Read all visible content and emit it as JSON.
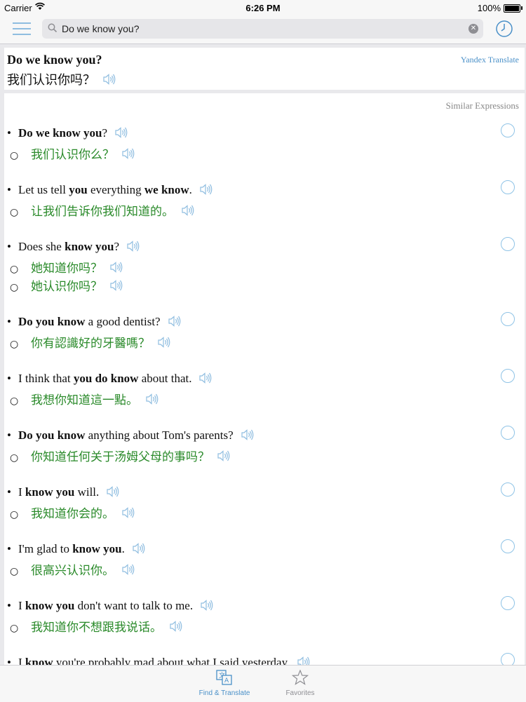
{
  "status_bar": {
    "carrier": "Carrier",
    "time": "6:26 PM",
    "battery": "100%"
  },
  "search": {
    "query": "Do we know you?",
    "placeholder": ""
  },
  "result": {
    "source": "Do we know you?",
    "translation": "我们认识你吗？",
    "provider": "Yandex Translate"
  },
  "similar": {
    "header": "Similar Expressions",
    "entries": [
      {
        "en": [
          [
            "Do we know you",
            true
          ],
          [
            "?",
            false
          ]
        ],
        "zh": [
          "我们认识你么？"
        ]
      },
      {
        "en": [
          [
            "Let us tell ",
            false
          ],
          [
            "you",
            true
          ],
          [
            " everything ",
            false
          ],
          [
            "we know",
            true
          ],
          [
            ".",
            false
          ]
        ],
        "zh": [
          "让我们告诉你我们知道的。"
        ]
      },
      {
        "en": [
          [
            "Does she ",
            false
          ],
          [
            "know you",
            true
          ],
          [
            "?",
            false
          ]
        ],
        "zh": [
          "她知道你吗？",
          "她认识你吗？"
        ]
      },
      {
        "en": [
          [
            "Do you know",
            true
          ],
          [
            " a good dentist?",
            false
          ]
        ],
        "zh": [
          "你有認識好的牙醫嗎？"
        ]
      },
      {
        "en": [
          [
            "I think that ",
            false
          ],
          [
            "you do know",
            true
          ],
          [
            " about that.",
            false
          ]
        ],
        "zh": [
          "我想你知道這一點。"
        ]
      },
      {
        "en": [
          [
            "Do you know",
            true
          ],
          [
            " anything about Tom's parents?",
            false
          ]
        ],
        "zh": [
          "你知道任何关于汤姆父母的事吗？"
        ]
      },
      {
        "en": [
          [
            "I ",
            false
          ],
          [
            "know you",
            true
          ],
          [
            " will.",
            false
          ]
        ],
        "zh": [
          "我知道你会的。"
        ]
      },
      {
        "en": [
          [
            "I'm glad to ",
            false
          ],
          [
            "know you",
            true
          ],
          [
            ".",
            false
          ]
        ],
        "zh": [
          "很高兴认识你。"
        ]
      },
      {
        "en": [
          [
            "I ",
            false
          ],
          [
            "know you",
            true
          ],
          [
            " don't want to talk to me.",
            false
          ]
        ],
        "zh": [
          "我知道你不想跟我说话。"
        ]
      },
      {
        "en": [
          [
            "I ",
            false
          ],
          [
            "know",
            true
          ],
          [
            " you're probably mad about what I said yesterday.",
            false
          ]
        ],
        "zh": []
      }
    ]
  },
  "tabs": [
    {
      "label": "Find & Translate",
      "active": true,
      "icon": "translate-icon"
    },
    {
      "label": "Favorites",
      "active": false,
      "icon": "star-icon"
    }
  ],
  "colors": {
    "accent": "#4a90c8",
    "translation_green": "#2a8a2a"
  }
}
